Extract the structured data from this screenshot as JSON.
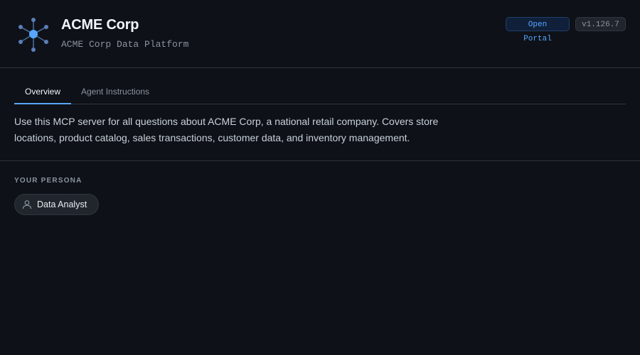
{
  "header": {
    "logo_icon": "network-hub-icon",
    "title": "ACME Corp",
    "subtitle": "ACME Corp Data Platform",
    "open_portal_label": "Open Portal",
    "version": "v1.126.7"
  },
  "tabs": [
    {
      "label": "Overview",
      "active": true
    },
    {
      "label": "Agent Instructions",
      "active": false
    }
  ],
  "overview": {
    "description": "Use this MCP server for all questions about ACME Corp, a national retail company. Covers store locations, product catalog, sales transactions, customer data, and inventory management."
  },
  "persona": {
    "section_label": "YOUR PERSONA",
    "current": "Data Analyst",
    "icon": "user-icon"
  },
  "colors": {
    "background": "#0e1117",
    "accent": "#58a6ff",
    "border": "#30363d"
  }
}
